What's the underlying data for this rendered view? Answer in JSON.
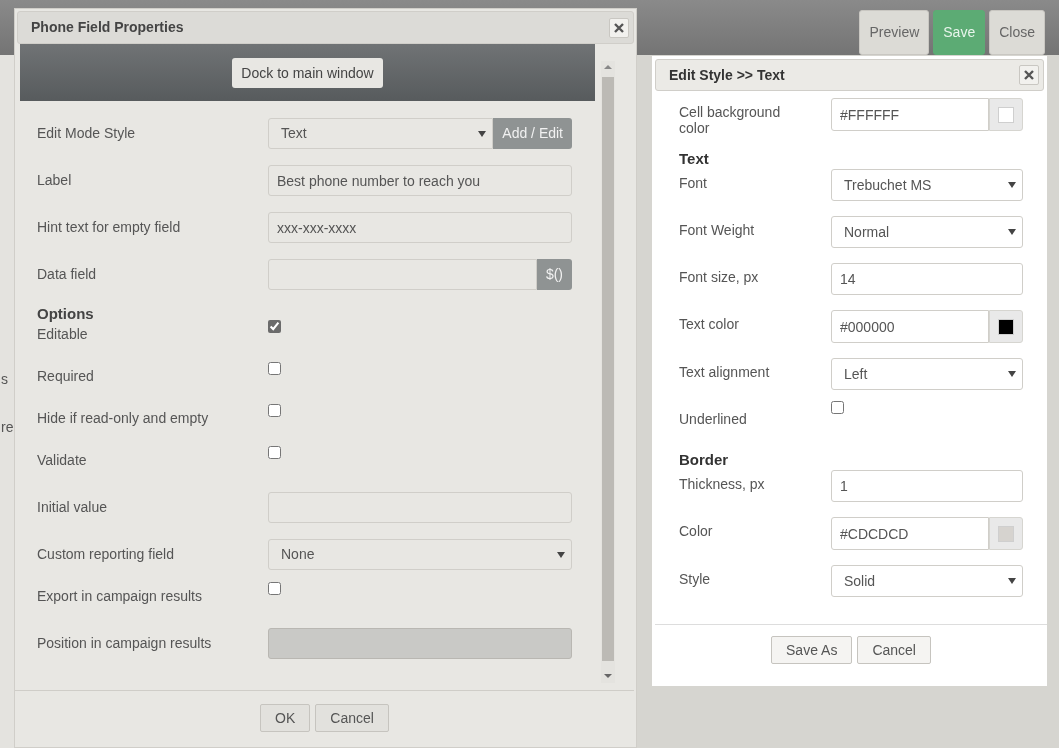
{
  "background": {
    "fragments": [
      "s",
      "re"
    ]
  },
  "toolbar": {
    "buttons": [
      {
        "label": "Preview",
        "kind": "default"
      },
      {
        "label": "Save",
        "kind": "primary"
      },
      {
        "label": "Close",
        "kind": "default"
      }
    ]
  },
  "phone_dialog": {
    "title": "Phone Field Properties",
    "dock_button": "Dock to main window",
    "rows": [
      {
        "kind": "select",
        "label": "Edit Mode Style",
        "value": "Text",
        "addon": "Add / Edit"
      },
      {
        "kind": "input",
        "label": "Label",
        "value": "Best phone number to reach you",
        "disabled": false
      },
      {
        "kind": "input",
        "label": "Hint text for empty field",
        "value": "xxx-xxx-xxxx",
        "disabled": false
      },
      {
        "kind": "input",
        "label": "Data field",
        "addon": "$()",
        "disabled": false
      },
      {
        "kind": "heading",
        "label": "Options"
      },
      {
        "kind": "checkbox",
        "label": "Editable",
        "checked": true
      },
      {
        "kind": "checkbox",
        "label": "Required",
        "checked": false
      },
      {
        "kind": "checkbox",
        "label": "Hide if read-only and empty",
        "checked": false
      },
      {
        "kind": "checkbox",
        "label": "Validate",
        "checked": false
      },
      {
        "kind": "input",
        "label": "Initial value",
        "disabled": false
      },
      {
        "kind": "select",
        "label": "Custom reporting field",
        "value": "None"
      },
      {
        "kind": "checkbox",
        "label": "Export in campaign results",
        "checked": false
      },
      {
        "kind": "input",
        "label": "Position in campaign results",
        "disabled": true
      }
    ],
    "buttons": [
      "OK",
      "Cancel"
    ]
  },
  "style_dialog": {
    "title": "Edit Style >> Text",
    "rows": [
      {
        "kind": "color",
        "label": "Cell background color",
        "value": "#FFFFFF",
        "color": "#ffffff"
      },
      {
        "kind": "heading",
        "label": "Text"
      },
      {
        "kind": "select",
        "label": "Font",
        "value": "Trebuchet MS"
      },
      {
        "kind": "select",
        "label": "Font Weight",
        "value": "Normal"
      },
      {
        "kind": "input",
        "label": "Font size, px",
        "value": "14",
        "disabled": false
      },
      {
        "kind": "color",
        "label": "Text color",
        "value": "#000000",
        "color": "#000000"
      },
      {
        "kind": "select",
        "label": "Text alignment",
        "value": "Left"
      },
      {
        "kind": "checkbox",
        "label": "Underlined",
        "checked": false
      },
      {
        "kind": "heading",
        "label": "Border"
      },
      {
        "kind": "input",
        "label": "Thickness, px",
        "value": "1",
        "disabled": false
      },
      {
        "kind": "color",
        "label": "Color",
        "value": "#CDCDCD",
        "color": "#d6d3cf"
      },
      {
        "kind": "select",
        "label": "Style",
        "value": "Solid"
      }
    ],
    "buttons": [
      "Save As",
      "Cancel"
    ]
  }
}
